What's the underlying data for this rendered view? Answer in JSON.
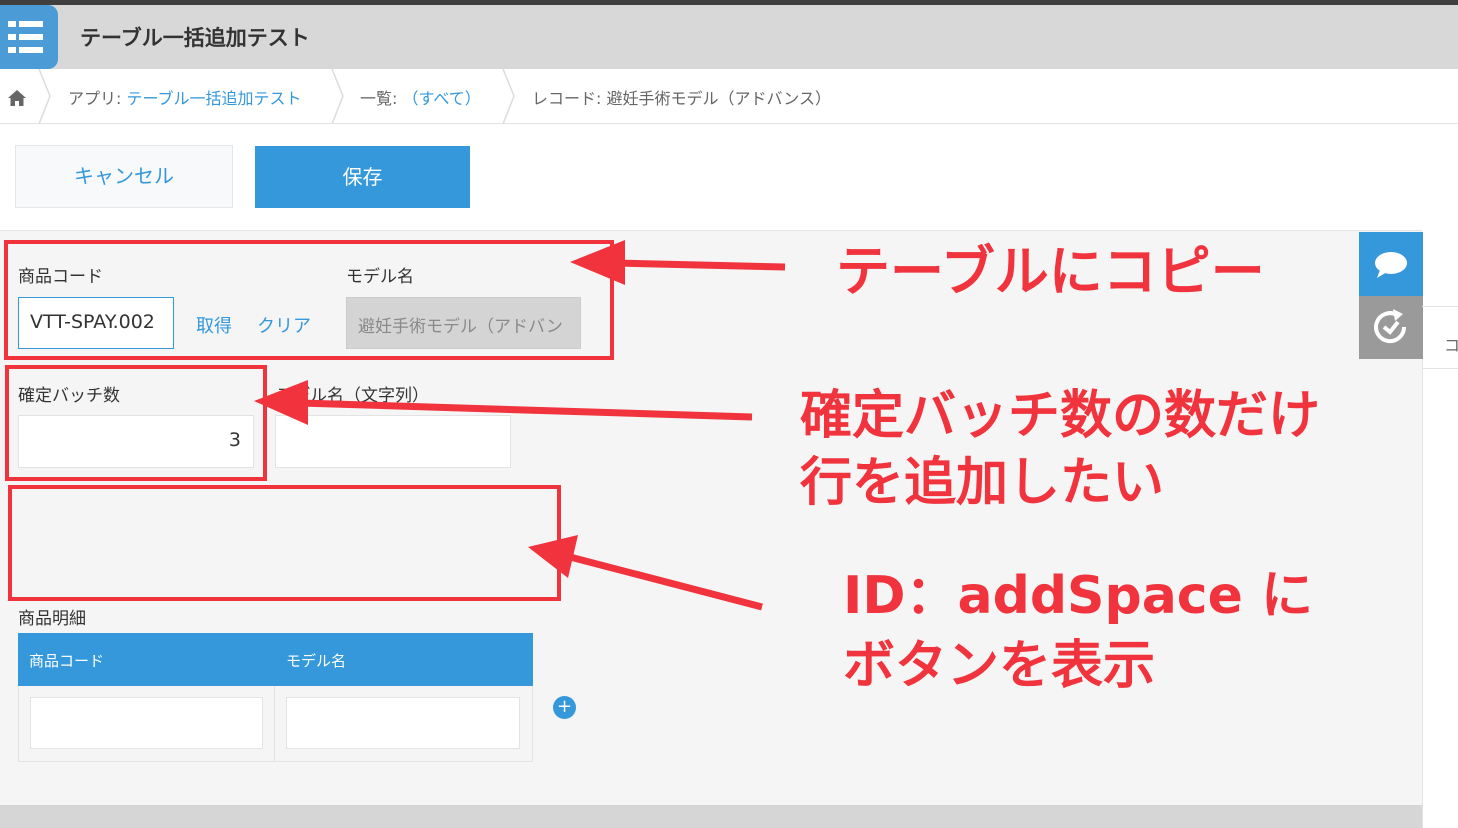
{
  "header": {
    "app_title": "テーブル一括追加テスト"
  },
  "breadcrumb": {
    "app_prefix": "アプリ: ",
    "app_link": "テーブル一括追加テスト",
    "list_prefix": "一覧: ",
    "list_link": "（すべて）",
    "record": "レコード: 避妊手術モデル（アドバンス）"
  },
  "toolbar": {
    "cancel_label": "キャンセル",
    "save_label": "保存"
  },
  "form": {
    "product_code_label": "商品コード",
    "product_code_value": "VTT-SPAY.002",
    "fetch_label": "取得",
    "clear_label": "クリア",
    "model_name_label": "モデル名",
    "model_name_value": "避妊手術モデル（アドバン",
    "batch_count_label": "確定バッチ数",
    "batch_count_value": "3",
    "model_name_str_label": "モデル名（文字列）",
    "model_name_str_value": "",
    "detail_label": "商品明細",
    "table_headers": [
      "商品コード",
      "モデル名"
    ],
    "add_row_symbol": "+"
  },
  "side_panel": {
    "partial_text": "コ"
  },
  "annotations": {
    "copy_to_table": "テーブルにコピー",
    "add_rows_line1": "確定バッチ数の数だけ",
    "add_rows_line2": "行を追加したい",
    "button_line1": "ID：addSpace に",
    "button_line2": "ボタンを表示"
  },
  "colors": {
    "accent": "#3498db",
    "annotation": "#f0333c"
  }
}
